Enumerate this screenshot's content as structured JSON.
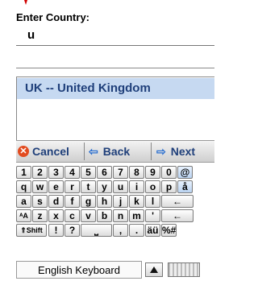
{
  "prompt": {
    "title": "Enter Country:"
  },
  "input": {
    "value": "u"
  },
  "results": [
    {
      "label": "UK -- United Kingdom"
    }
  ],
  "actions": {
    "cancel": "Cancel",
    "back": "Back",
    "next": "Next"
  },
  "keyboard": {
    "rows": [
      [
        "1",
        "2",
        "3",
        "4",
        "5",
        "6",
        "7",
        "8",
        "9",
        "0",
        "@"
      ],
      [
        "q",
        "w",
        "e",
        "r",
        "t",
        "y",
        "u",
        "i",
        "o",
        "p",
        "å"
      ],
      [
        "a",
        "s",
        "d",
        "f",
        "g",
        "h",
        "j",
        "k",
        "l",
        "←"
      ],
      [
        "ᴬA",
        "z",
        "x",
        "c",
        "v",
        "b",
        "n",
        "m",
        "'",
        "←"
      ],
      [
        "⇑Shift",
        "!",
        "?",
        "⎵",
        ",",
        ".",
        "äü",
        "%#"
      ]
    ],
    "name": "English Keyboard"
  },
  "colors": {
    "accent": "#1f3f7a",
    "highlight": "#c6d9f1",
    "cancel_icon": "#e24b1f"
  }
}
